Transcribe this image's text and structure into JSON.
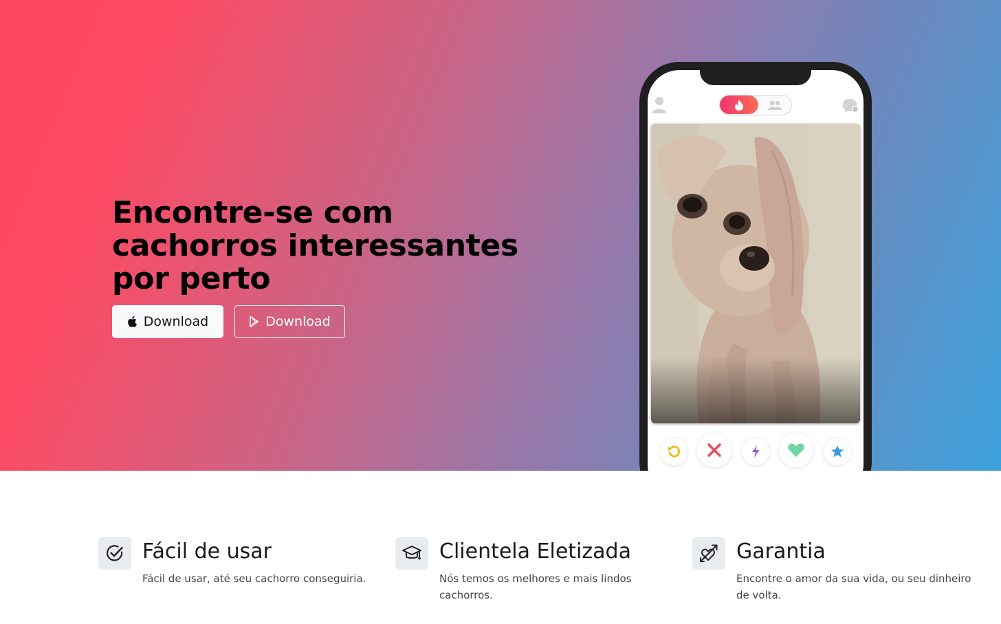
{
  "hero": {
    "title": "Encontre-se com cachorros interessantes por perto",
    "buttons": [
      {
        "label": "Download",
        "icon": "apple-icon",
        "style": "light"
      },
      {
        "label": "Download",
        "icon": "google-play-icon",
        "style": "outline"
      }
    ],
    "gradient": [
      "#fe4661",
      "#cd6384",
      "#9a78a9",
      "#6e87bd",
      "#3ea3dd"
    ]
  },
  "phone": {
    "top_bar": {
      "left_icon": "profile-icon",
      "toggle_active": "flame-icon",
      "toggle_inactive": "group-icon",
      "right_icon": "chat-icon"
    },
    "actions": [
      {
        "icon": "rewind-icon",
        "color": "#f5b400"
      },
      {
        "icon": "close-icon",
        "color": "#ea4a5a"
      },
      {
        "icon": "bolt-icon",
        "color": "#8e54c9"
      },
      {
        "icon": "heart-icon",
        "color": "#6fd4a6"
      },
      {
        "icon": "star-icon",
        "color": "#3a9be0"
      }
    ]
  },
  "features": [
    {
      "icon": "check-circle-icon",
      "title": "Fácil de usar",
      "description": "Fácil de usar, até seu cachorro conseguiria."
    },
    {
      "icon": "graduation-cap-icon",
      "title": "Clientela Eletizada",
      "description": "Nós temos os melhores e mais lindos cachorros."
    },
    {
      "icon": "heart-arrow-icon",
      "title": "Garantia",
      "description": "Encontre o amor da sua vida, ou seu dinheiro de volta."
    }
  ]
}
